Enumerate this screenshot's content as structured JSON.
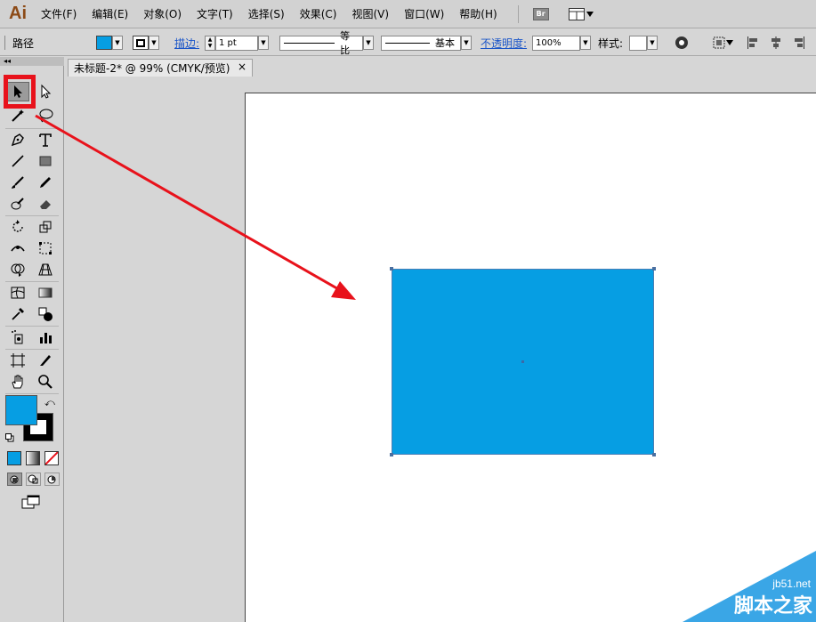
{
  "app": {
    "logo": "Ai"
  },
  "menubar": {
    "items": [
      "文件(F)",
      "编辑(E)",
      "对象(O)",
      "文字(T)",
      "选择(S)",
      "效果(C)",
      "视图(V)",
      "窗口(W)",
      "帮助(H)"
    ],
    "bridge_label": "Br"
  },
  "controlbar": {
    "selection_label": "路径",
    "stroke_label": "描边:",
    "stroke_weight": "1 pt",
    "stroke_profile": "等比",
    "brush_label": "基本",
    "opacity_label": "不透明度:",
    "opacity_value": "100%",
    "style_label": "样式:",
    "fill_color": "#069ee3"
  },
  "document": {
    "tab_title": "未标题-2* @ 99% (CMYK/预览)",
    "close_glyph": "×",
    "rect_fill": "#069ee3"
  },
  "tools": {
    "items": [
      "selection-tool",
      "direct-selection-tool",
      "magic-wand-tool",
      "lasso-tool",
      "pen-tool",
      "type-tool",
      "line-tool",
      "rectangle-tool",
      "paintbrush-tool",
      "pencil-tool",
      "blob-brush-tool",
      "eraser-tool",
      "rotate-tool",
      "scale-tool",
      "warp-tool",
      "free-transform-tool",
      "shape-builder-tool",
      "perspective-grid-tool",
      "mesh-tool",
      "gradient-tool",
      "eyedropper-tool",
      "blend-tool",
      "symbol-sprayer-tool",
      "column-graph-tool",
      "artboard-tool",
      "slice-tool",
      "hand-tool",
      "zoom-tool"
    ],
    "fill_color": "#069ee3",
    "stroke_color": "#000000"
  },
  "annotation": {
    "highlight_color": "#e8121b"
  },
  "watermark": {
    "site": "jb51.net",
    "name": "脚本之家",
    "color": "#3aa6e6"
  }
}
